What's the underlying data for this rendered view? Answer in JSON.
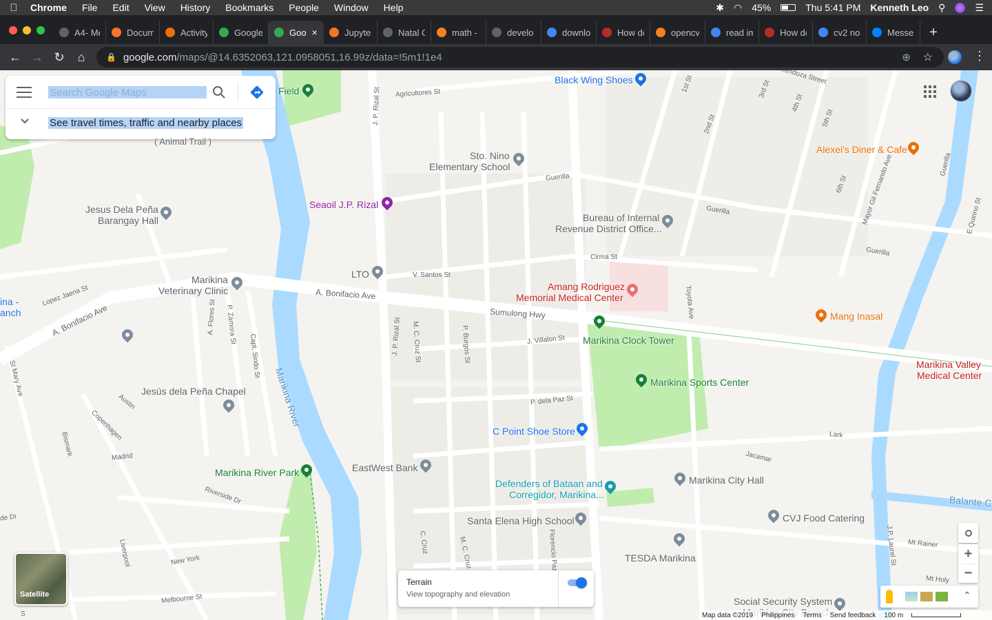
{
  "menubar": {
    "apple": "",
    "app": "Chrome",
    "items": [
      "File",
      "Edit",
      "View",
      "History",
      "Bookmarks",
      "People",
      "Window",
      "Help"
    ],
    "battery": "45%",
    "clock": "Thu 5:41 PM",
    "user": "Kenneth Leo"
  },
  "tabs": [
    {
      "label": "A4- Me",
      "favicon": "globe-icon",
      "color": "#5f6368"
    },
    {
      "label": "Docum",
      "favicon": "jupyter-icon",
      "color": "#f37626"
    },
    {
      "label": "Activity",
      "favicon": "edit-icon",
      "color": "#e8710a"
    },
    {
      "label": "Google",
      "favicon": "maps-icon",
      "color": "#34a853"
    },
    {
      "label": "Goo",
      "favicon": "maps-icon",
      "color": "#34a853",
      "active": true
    },
    {
      "label": "Jupyte",
      "favicon": "jupyter-icon",
      "color": "#f37626"
    },
    {
      "label": "Natal C",
      "favicon": "globe-icon",
      "color": "#5f6368"
    },
    {
      "label": "math -",
      "favicon": "stack-icon",
      "color": "#f48024"
    },
    {
      "label": "develo",
      "favicon": "globe-icon",
      "color": "#5f6368"
    },
    {
      "label": "downlo",
      "favicon": "google-icon",
      "color": "#4285f4"
    },
    {
      "label": "How do",
      "favicon": "quora-icon",
      "color": "#b92b27"
    },
    {
      "label": "opencv",
      "favicon": "stack-icon",
      "color": "#f48024"
    },
    {
      "label": "read im",
      "favicon": "google-icon",
      "color": "#4285f4"
    },
    {
      "label": "How do",
      "favicon": "quora-icon",
      "color": "#b92b27"
    },
    {
      "label": "cv2 no",
      "favicon": "google-icon",
      "color": "#4285f4"
    },
    {
      "label": "Messe",
      "favicon": "messenger-icon",
      "color": "#0084ff"
    }
  ],
  "omnibox": {
    "host": "google.com",
    "path": "/maps/@14.6352063,121.0958051,16.99z/data=!5m1!1e4"
  },
  "search": {
    "placeholder": "Search Google Maps",
    "travel": "See travel times, traffic and nearby places"
  },
  "places": {
    "field": "Field",
    "black_wing": "Black Wing Shoes",
    "sto_nino_1": "Sto. Nino",
    "sto_nino_2": "Elementary School",
    "alexeis": "Alexei's Diner & Cafe",
    "animal_trail": "( Animal Trail )",
    "seaoil": "Seaoil J.P. Rizal",
    "bir_1": "Bureau of Internal",
    "bir_2": "Revenue District Office...",
    "dela_pena_1": "Jesus Dela Peña",
    "dela_pena_2": "Barangay Hall",
    "lto": "LTO",
    "vet_1": "Marikina",
    "vet_2": "Veterinary Clinic",
    "amang_1": "Amang Rodriguez",
    "amang_2": "Memorial Medical Center",
    "mang_inasal": "Mang Inasal",
    "left_cut_1": "ina -",
    "left_cut_2": "anch",
    "clock_tower": "Marikina Clock Tower",
    "sports_center": "Marikina Sports Center",
    "valley_1": "Marikina Valley",
    "valley_2": "Medical Center",
    "chapel": "Jesús dela Peña Chapel",
    "c_point": "C Point Shoe Store",
    "eastwest": "EastWest Bank",
    "river_park": "Marikina River Park",
    "defenders_1": "Defenders of Bataan and",
    "defenders_2": "Corregidor, Marikina...",
    "city_hall": "Marikina City Hall",
    "santa_elena": "Santa Elena High School",
    "cvj": "CVJ Food Catering",
    "tesda": "TESDA Marikina",
    "sss_1": "Social Security System",
    "sss_2": "Marikina City Branch",
    "river": "Marikina River",
    "balante": "Balante C"
  },
  "streets": {
    "agricultores": "Agricultores St",
    "jp_rizal": "J. P. Rizal St",
    "mendoza": "Mendoza Street",
    "first": "1st St",
    "second": "2nd St",
    "third": "3rd St",
    "fourth": "4th St",
    "fifth": "5th St",
    "sixth": "6th St",
    "mayor_gil": "Mayor Gil Fernando Ave",
    "guerilla": "Guerilla",
    "e_quirino": "E Quirino St",
    "cirma": "Cirma St",
    "v_santos": "V. Santos St",
    "lopez_jaena": "Lopez Jaena St",
    "a_bonifacio": "A. Bonifacio Ave",
    "sumulong": "Sumulong Hwy",
    "toyota": "Toyota Ave",
    "a_flores": "A. Flores St",
    "p_zamora": "P. Zamora St",
    "capt_sindo": "Capt. Sindo St",
    "jp_rizal2": "J. P. Rizal St",
    "mc_cruz": "M. C. Cruz St",
    "p_burgos": "P. Burgos St",
    "j_villalon": "J. Villalon St",
    "st_mary": "St Mary Ave",
    "austin": "Austin",
    "copenhagen": "Copenhagen",
    "bismark": "Bismark",
    "madrid": "Madrid",
    "p_dela_paz": "P. dela Paz St",
    "lark": "Lark",
    "jacamar": "Jacamar",
    "riverside": "Riverside Dr",
    "de_dr": "de Dr",
    "liverpool": "Liverpool",
    "new_york": "New York",
    "melbourne": "Melbourne St",
    "c_cruz": "C. Cruz",
    "mc_cruz2": "M. C. Cruz",
    "florencio": "Florencio Paz",
    "jp_laurel": "J.P. Laurel St",
    "mt_rainer": "Mt Rainer",
    "mt_holy": "Mt Holy",
    "s_cut": "S"
  },
  "controls": {
    "satellite": "Satellite",
    "terrain_title": "Terrain",
    "terrain_sub": "View topography and elevation",
    "zoom_in": "+",
    "zoom_out": "−"
  },
  "footer": {
    "mapdata": "Map data ©2019",
    "region": "Philippines",
    "terms": "Terms",
    "feedback": "Send feedback",
    "scale": "100 m"
  },
  "colors": {
    "park": "#c0ecae",
    "water": "#aadaff",
    "road": "#ffffff",
    "block": "#eae8e3",
    "hospital_pink": "#f8e0e0",
    "poi_blue": "#1a73e8",
    "poi_green": "#188038",
    "poi_orange": "#e8710a",
    "poi_red": "#c5221f",
    "poi_gray": "#5f6368",
    "poi_teal": "#129eaf"
  }
}
